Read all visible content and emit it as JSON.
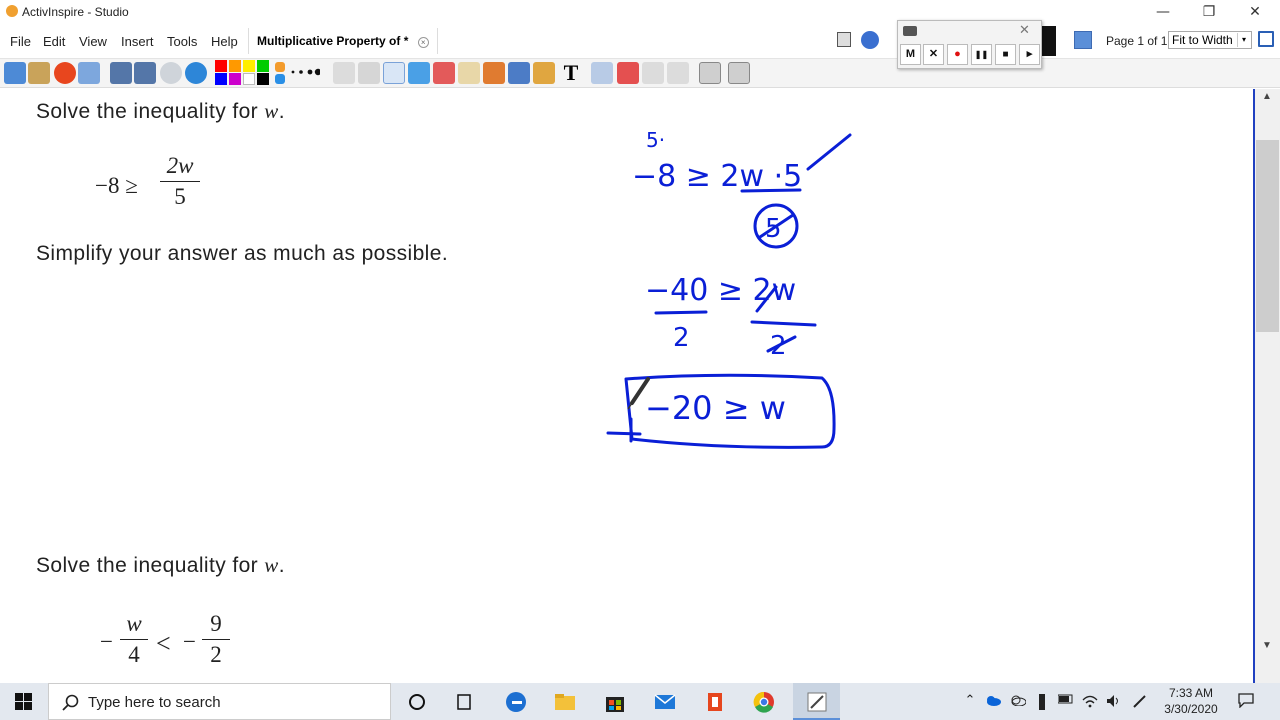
{
  "window": {
    "title": "ActivInspire - Studio",
    "minimize": "—",
    "restore": "❐",
    "close": "✕"
  },
  "menu": [
    "File",
    "Edit",
    "View",
    "Insert",
    "Tools",
    "Help"
  ],
  "document_tab": {
    "label": "Multiplicative Property of *",
    "close": "×"
  },
  "page_indicator": "Page 1 of 1",
  "zoom": {
    "value": "Fit to Width",
    "arrow": "▾"
  },
  "recorder": {
    "buttons": [
      "M",
      "✕",
      "●",
      "❚❚",
      "■",
      "▸"
    ],
    "close": "✕"
  },
  "problems": [
    {
      "prompt_before": "Solve the inequality for ",
      "variable": "w",
      "prompt_after": ".",
      "lhs": "−8 ≥",
      "numerator": "2w",
      "denominator": "5",
      "instruction": "Simplify your answer as much as possible."
    },
    {
      "prompt_before": "Solve the inequality for ",
      "variable": "w",
      "prompt_after": ".",
      "lhs_minus": "−",
      "numerator": "w",
      "denominator": "4",
      "relation": "<",
      "rhs_minus": "−",
      "rhs_numerator": "9",
      "rhs_denominator": "2"
    }
  ],
  "handwriting": {
    "ink_color": "#0a1fd6",
    "lines": [
      "5·",
      "−8 ≥ 2w ·5",
      "5",
      "−40 ≥ 2w",
      "2",
      "2",
      "−20 ≥ w"
    ]
  },
  "scrollbar": {
    "up": "▲",
    "down": "▼"
  },
  "taskbar": {
    "search_placeholder": "Type here to search",
    "time": "7:33 AM",
    "date": "3/30/2020"
  }
}
